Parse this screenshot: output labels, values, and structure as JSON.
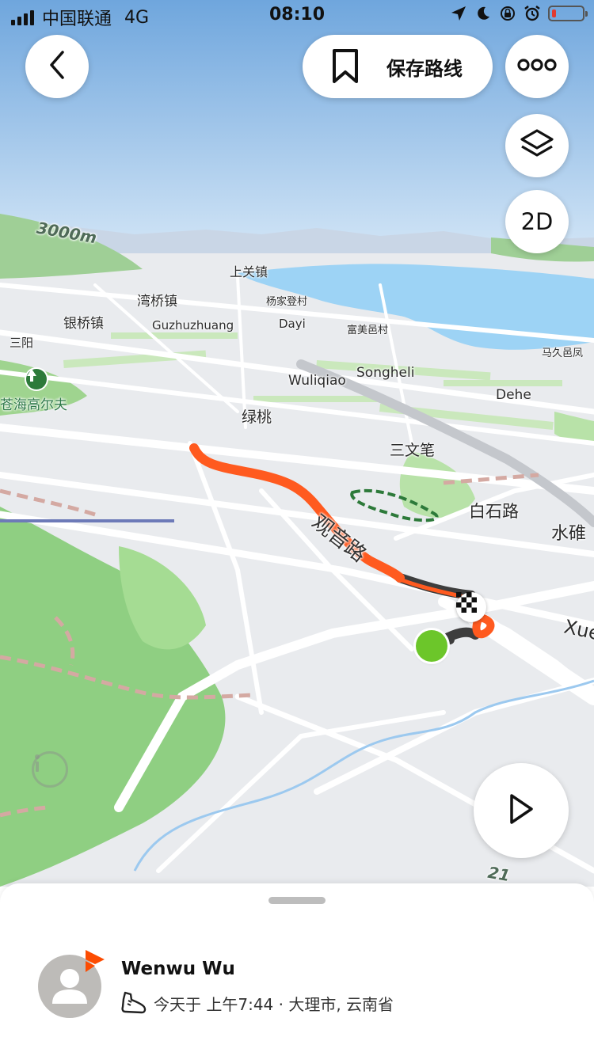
{
  "status_bar": {
    "carrier": "中国联通",
    "network": "4G",
    "time": "08:10",
    "battery_level": 0.15,
    "battery_color": "#e23a2f"
  },
  "toolbar": {
    "back_icon": "chevron-left-icon",
    "save_label": "保存路线",
    "save_icon": "bookmark-icon",
    "more_icon": "more-dots-icon",
    "layers_icon": "layers-icon",
    "view_mode_label": "2D",
    "play_icon": "play-icon",
    "info_icon": "info-icon"
  },
  "map": {
    "route_color": "#ff5a1f",
    "start_color": "#6cc62a",
    "finish_icon": "checkered-flag-icon",
    "labels": [
      {
        "text": "上关镇"
      },
      {
        "text": "湾桥镇"
      },
      {
        "text": "杨家登村"
      },
      {
        "text": "银桥镇"
      },
      {
        "text": "Guzhuzhuang"
      },
      {
        "text": "Dayi"
      },
      {
        "text": "富美邑村"
      },
      {
        "text": "三阳"
      },
      {
        "text": "马久邑凤"
      },
      {
        "text": "苍海高尔夫"
      },
      {
        "text": "Wuliqiao"
      },
      {
        "text": "Songheli"
      },
      {
        "text": "Dehe"
      },
      {
        "text": "绿桃"
      },
      {
        "text": "三文笔"
      },
      {
        "text": "白石路"
      },
      {
        "text": "水碓"
      },
      {
        "text": "Xue"
      },
      {
        "text": "观音路"
      },
      {
        "text": "3000m"
      },
      {
        "text": "21"
      }
    ]
  },
  "activity": {
    "user_name": "Wenwu Wu",
    "sport_icon": "running-shoe-icon",
    "summary": "今天于 上午7:44 · 大理市, 云南省",
    "brand_color": "#fc4c02"
  }
}
